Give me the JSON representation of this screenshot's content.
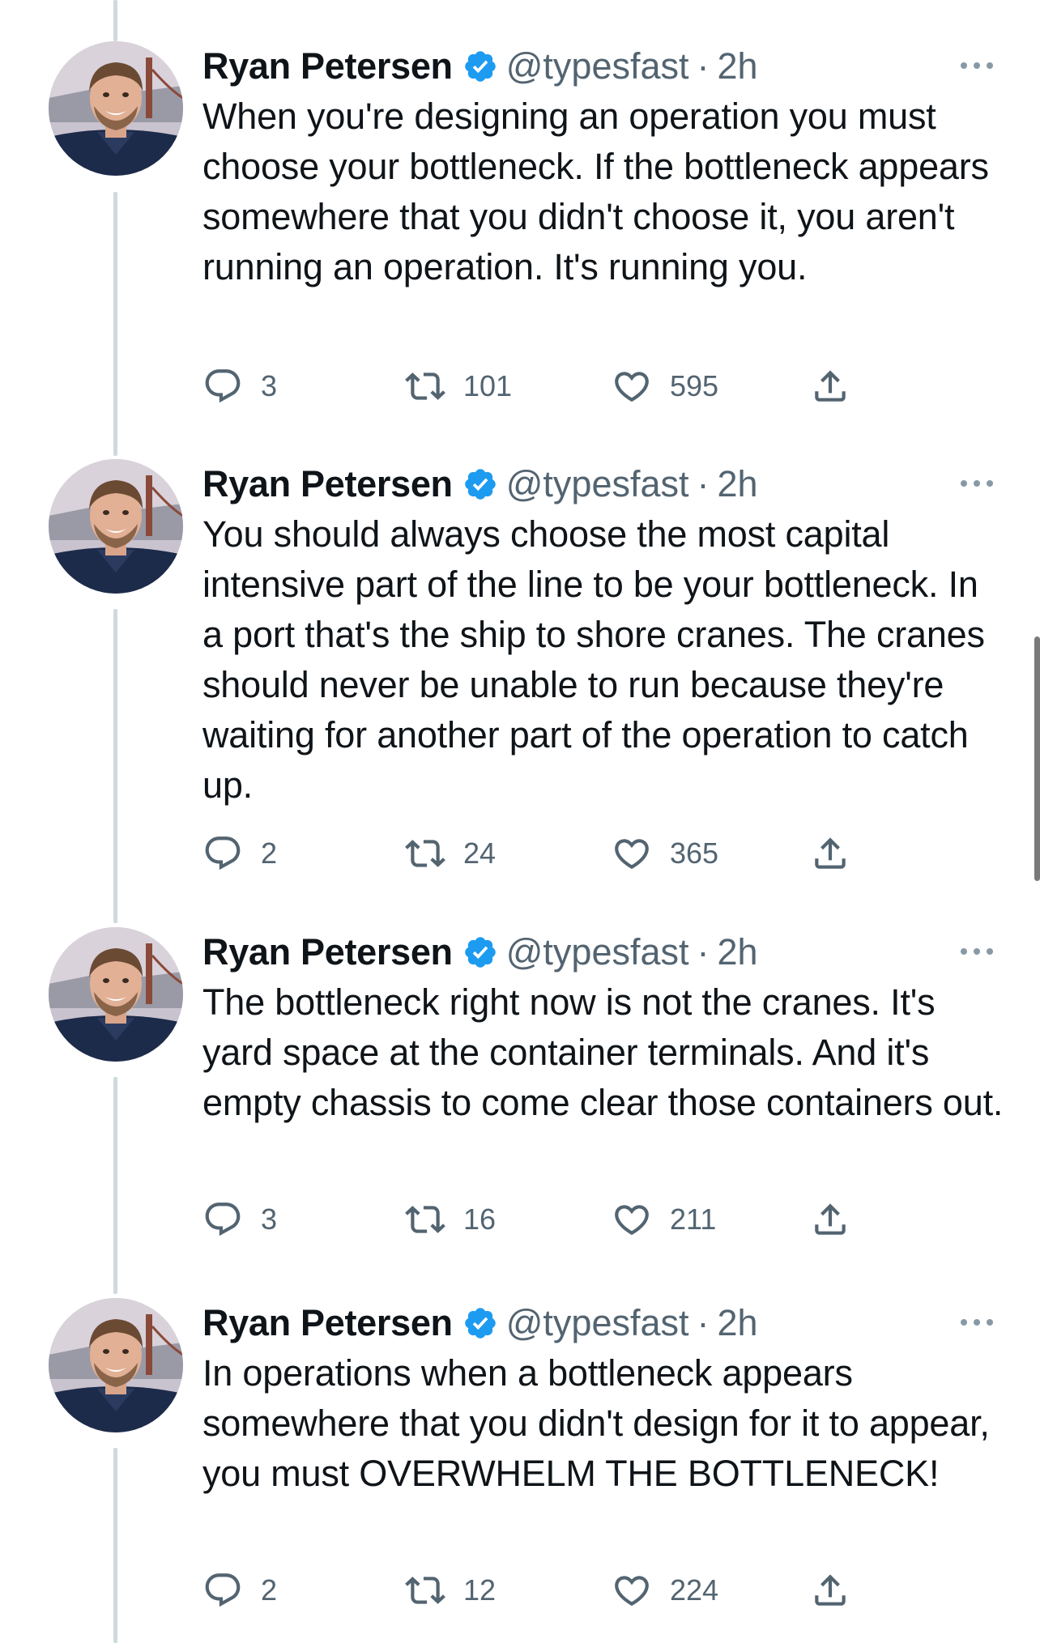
{
  "colors": {
    "verified": "#1d9bf0",
    "secondary_text": "#536471",
    "thread_line": "#cfd9de",
    "primary_text": "#0f1419"
  },
  "icons": {
    "reply": "reply-icon",
    "retweet": "retweet-icon",
    "like": "heart-icon",
    "share": "share-icon",
    "verified": "verified-badge-icon",
    "more": "more-options-icon"
  },
  "tweets": [
    {
      "author_name": "Ryan Petersen",
      "handle": "@typesfast",
      "separator": "·",
      "time": "2h",
      "text": "When you're designing an operation you must choose your bottleneck. If the bottleneck appears somewhere that you didn't choose it, you aren't running an operation. It's running you.",
      "replies": "3",
      "retweets": "101",
      "likes": "595"
    },
    {
      "author_name": "Ryan Petersen",
      "handle": "@typesfast",
      "separator": "·",
      "time": "2h",
      "text": "You should always choose the most capital intensive part of the line to be your bottleneck. In a port that's the ship to shore cranes. The cranes should never be unable to run because they're waiting for another part of the operation to catch up.",
      "replies": "2",
      "retweets": "24",
      "likes": "365"
    },
    {
      "author_name": "Ryan Petersen",
      "handle": "@typesfast",
      "separator": "·",
      "time": "2h",
      "text": "The bottleneck right now is not the cranes. It's yard space at the container terminals. And it's empty chassis to come clear those containers out.",
      "replies": "3",
      "retweets": "16",
      "likes": "211"
    },
    {
      "author_name": "Ryan Petersen",
      "handle": "@typesfast",
      "separator": "·",
      "time": "2h",
      "text": "In operations when a bottleneck appears somewhere that you didn't design for it to appear, you must OVERWHELM THE BOTTLENECK!",
      "replies": "2",
      "retweets": "12",
      "likes": "224"
    }
  ]
}
